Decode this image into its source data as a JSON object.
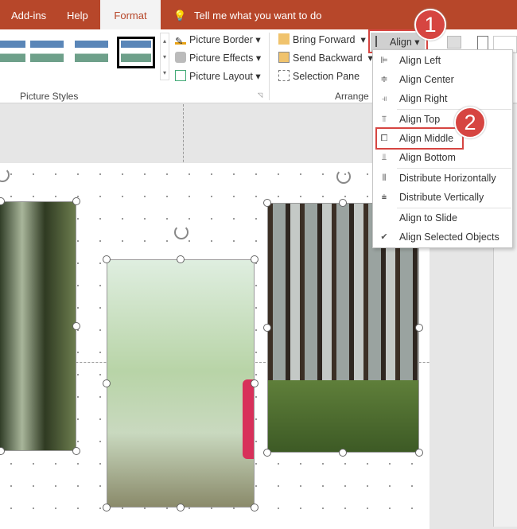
{
  "tabs": [
    {
      "label": "Add-ins"
    },
    {
      "label": "Help"
    },
    {
      "label": "Format",
      "active": true
    }
  ],
  "tell_me": "Tell me what you want to do",
  "ribbon": {
    "picture_border": "Picture Border",
    "picture_effects": "Picture Effects",
    "picture_layout": "Picture Layout",
    "picture_styles_label": "Picture Styles",
    "bring_forward": "Bring Forward",
    "send_backward": "Send Backward",
    "selection_pane": "Selection Pane",
    "arrange_label": "Arrange",
    "align": "Align"
  },
  "align_menu": [
    {
      "label": "Align Left",
      "icon": "align-left-icon"
    },
    {
      "label": "Align Center",
      "icon": "align-center-icon"
    },
    {
      "label": "Align Right",
      "icon": "align-right-icon"
    },
    {
      "label": "Align Top",
      "icon": "align-top-icon"
    },
    {
      "label": "Align Middle",
      "icon": "align-middle-icon",
      "highlighted": true
    },
    {
      "label": "Align Bottom",
      "icon": "align-bottom-icon"
    },
    {
      "label": "Distribute Horizontally",
      "icon": "distribute-horizontal-icon"
    },
    {
      "label": "Distribute Vertically",
      "icon": "distribute-vertical-icon"
    },
    {
      "label": "Align to Slide"
    },
    {
      "label": "Align Selected Objects",
      "checked": true
    }
  ],
  "callouts": [
    "1",
    "2"
  ],
  "colors": {
    "accent": "#b7472a",
    "callout": "#d64541"
  }
}
